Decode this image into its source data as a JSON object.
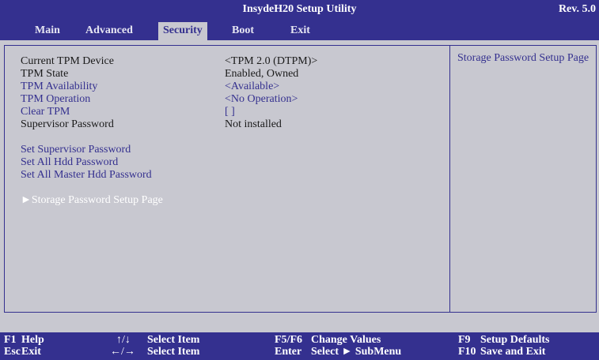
{
  "header": {
    "title": "InsydeH20 Setup Utility",
    "revision": "Rev. 5.0"
  },
  "menu": {
    "main": "Main",
    "advanced": "Advanced",
    "security": "Security",
    "boot": "Boot",
    "exit": "Exit"
  },
  "items": {
    "current_tpm_device": {
      "label": "Current TPM Device",
      "value": "<TPM 2.0 (DTPM)>"
    },
    "tpm_state": {
      "label": "TPM State",
      "value": "Enabled, Owned"
    },
    "tpm_availability": {
      "label": "TPM Availability",
      "value": "<Available>"
    },
    "tpm_operation": {
      "label": "TPM Operation",
      "value": "<No Operation>"
    },
    "clear_tpm": {
      "label": "Clear TPM",
      "value": "[ ]"
    },
    "supervisor_password": {
      "label": "Supervisor Password",
      "value": "Not installed"
    },
    "set_supervisor_password": {
      "label": "Set Supervisor Password"
    },
    "set_all_hdd_password": {
      "label": "Set All Hdd Password"
    },
    "set_all_master_hdd_password": {
      "label": "Set All Master Hdd Password"
    },
    "storage_password_setup_page": {
      "label": "►Storage Password Setup Page"
    }
  },
  "help": {
    "text": "Storage Password Setup Page"
  },
  "footer": {
    "f1_key": "F1",
    "f1_action": "Help",
    "esc_key": "Esc",
    "esc_action": "Exit",
    "updown_key": "↑/↓",
    "updown_action": "Select Item",
    "leftright_key": "←/→",
    "leftright_action": "Select Item",
    "f5f6_key": "F5/F6",
    "f5f6_action": "Change Values",
    "enter_key": "Enter",
    "enter_action": "Select ► SubMenu",
    "f9_key": "F9",
    "f9_action": "Setup Defaults",
    "f10_key": "F10",
    "f10_action": "Save and Exit"
  },
  "colors": {
    "accent": "#34308f",
    "background": "#c8c8d0",
    "selected_text": "#ffffff"
  }
}
